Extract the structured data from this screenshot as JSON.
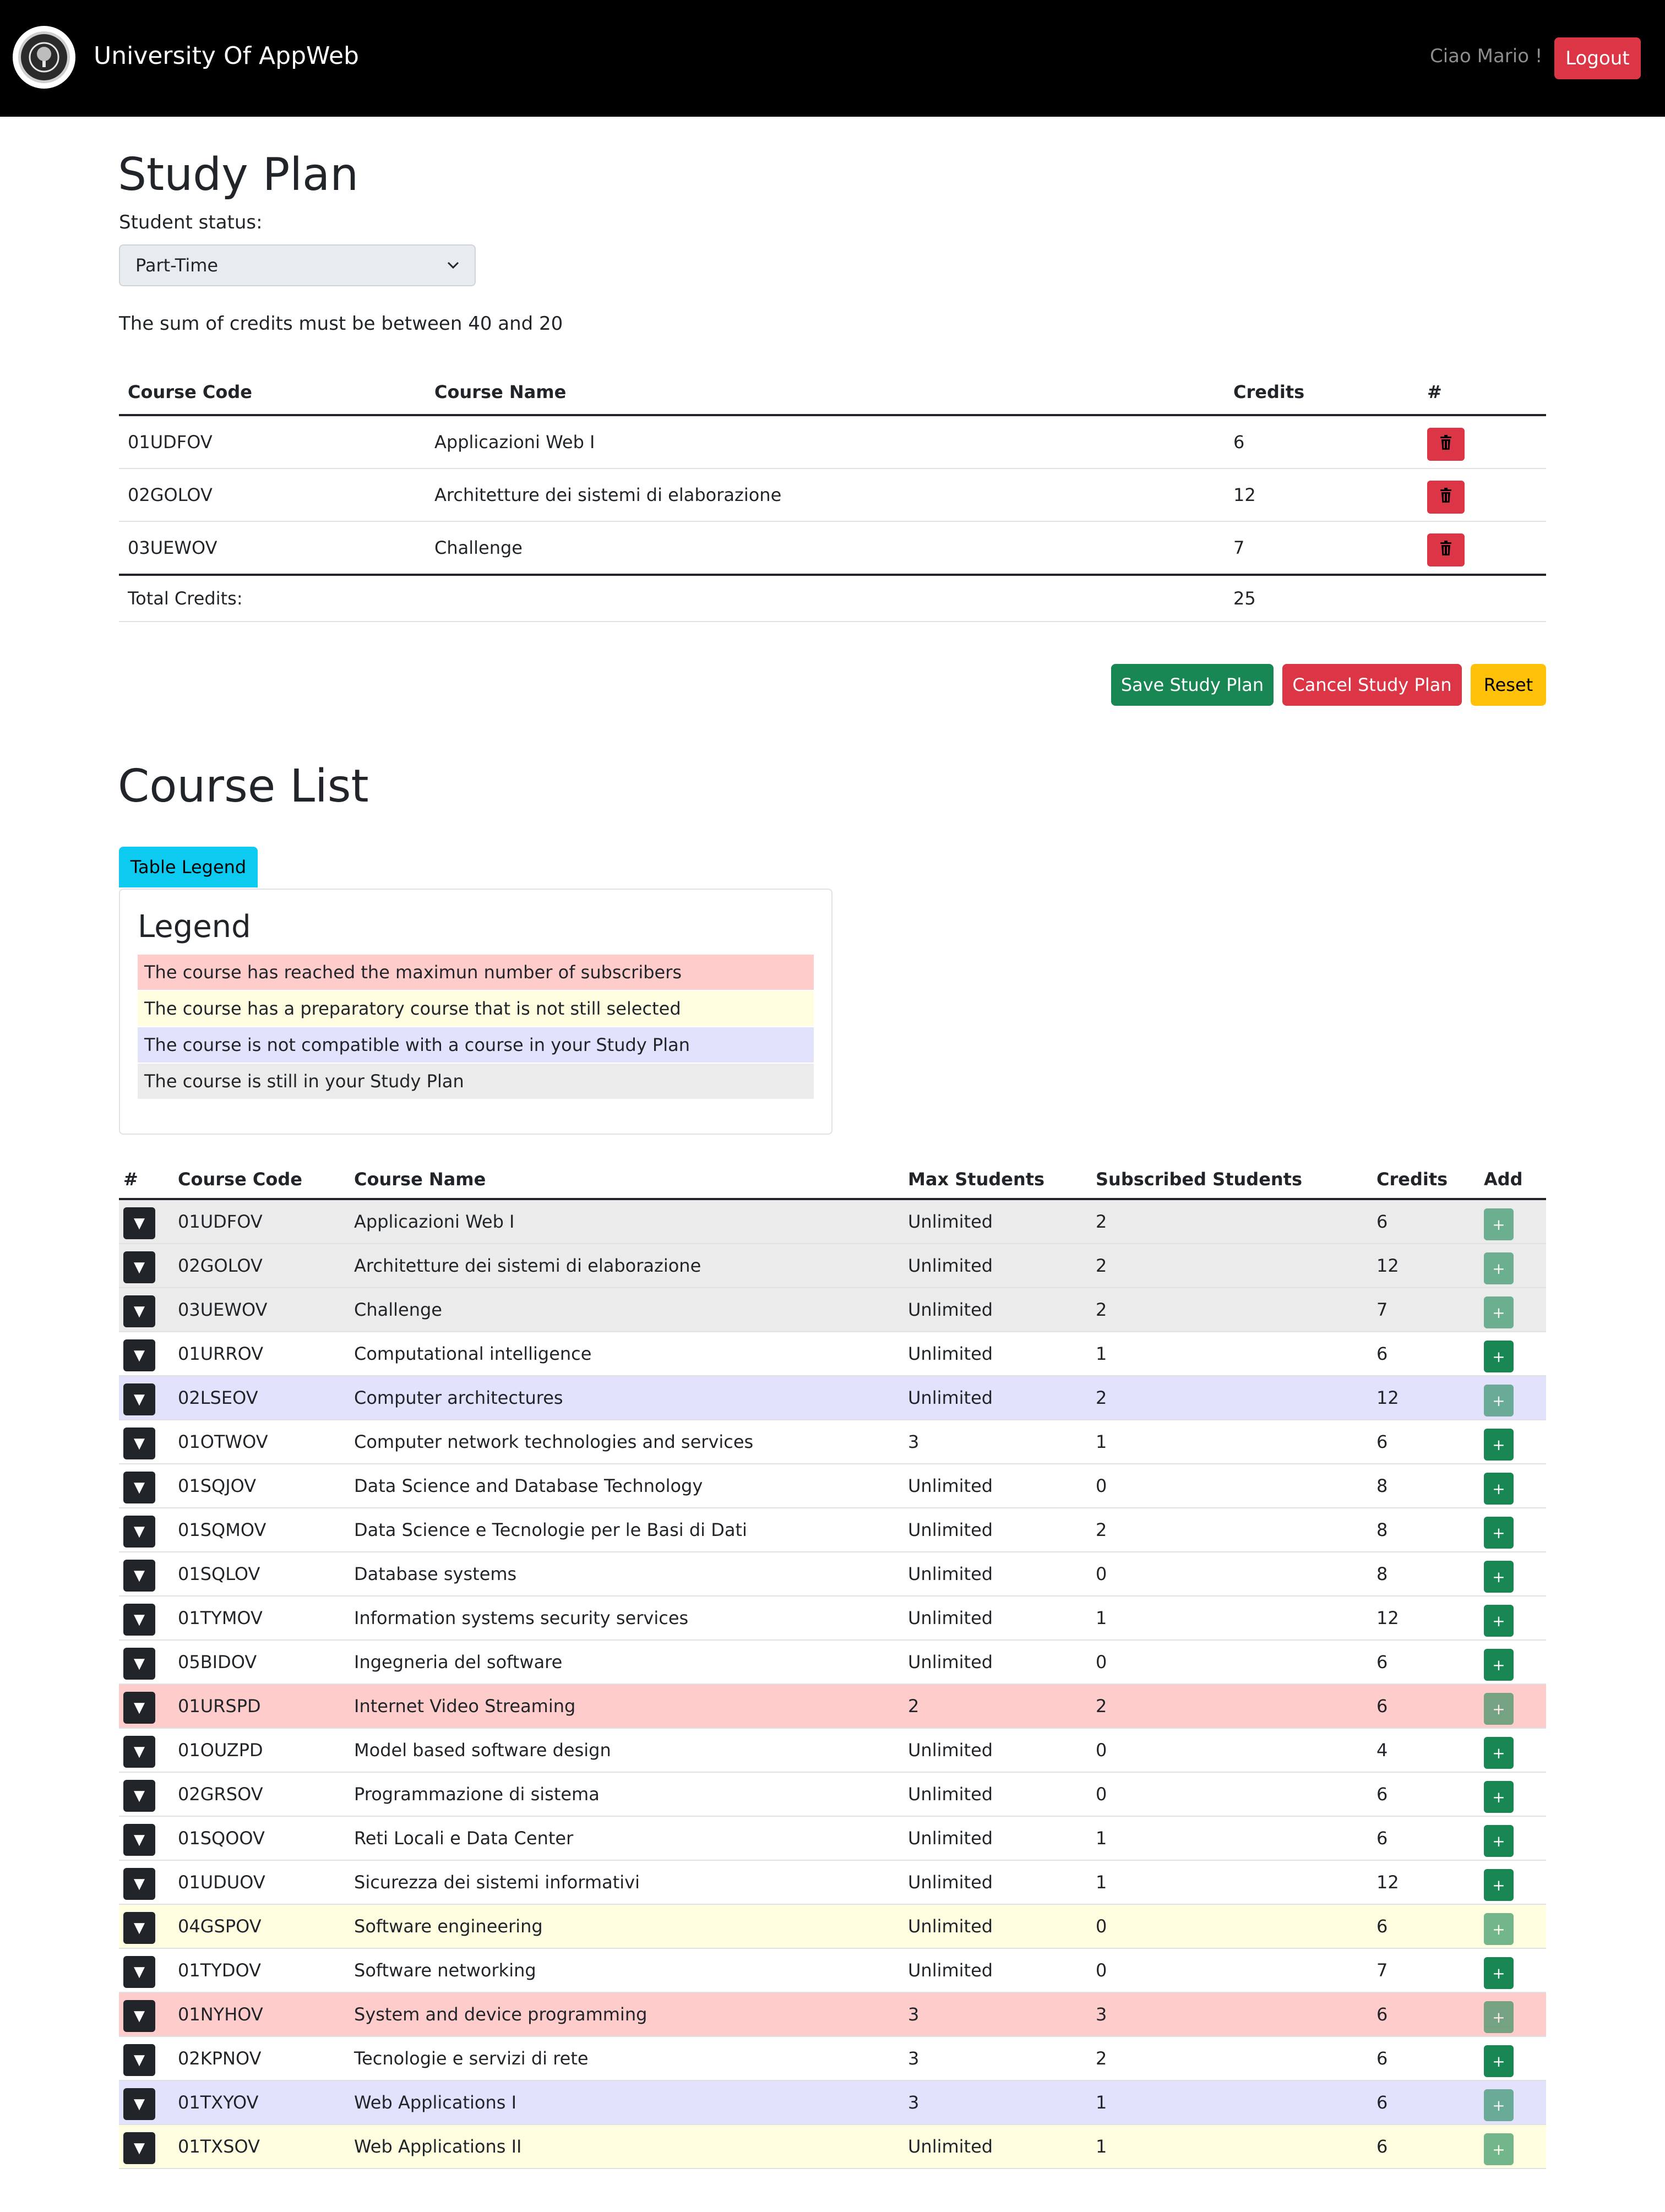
{
  "navbar": {
    "brand": "University Of AppWeb",
    "logo_icon": "university-seal-icon",
    "greeting": "Ciao Mario !",
    "logout_label": "Logout"
  },
  "study_plan": {
    "title": "Study Plan",
    "status_label": "Student status:",
    "status_value": "Part-Time",
    "credits_note": "The sum of credits must be between 40 and 20",
    "headers": [
      "Course Code",
      "Course Name",
      "Credits",
      "#"
    ],
    "rows": [
      {
        "code": "01UDFOV",
        "name": "Applicazioni Web I",
        "credits": "6"
      },
      {
        "code": "02GOLOV",
        "name": "Architetture dei sistemi di elaborazione",
        "credits": "12"
      },
      {
        "code": "03UEWOV",
        "name": "Challenge",
        "credits": "7"
      }
    ],
    "total_label": "Total Credits:",
    "total_value": "25",
    "buttons": {
      "save": "Save Study Plan",
      "cancel": "Cancel Study Plan",
      "reset": "Reset"
    }
  },
  "course_list": {
    "title": "Course List",
    "legend_button": "Table Legend",
    "legend_title": "Legend",
    "legend_items": [
      {
        "text": "The course has reached the maximun number of subscribers",
        "color": "#ffcccc"
      },
      {
        "text": "The course has a preparatory course that is not still selected",
        "color": "#fffde0"
      },
      {
        "text": "The course is not compatible with a course in your Study Plan",
        "color": "#e2e2fc"
      },
      {
        "text": "The course is still in your Study Plan",
        "color": "#ebebeb"
      }
    ],
    "headers": [
      "#",
      "Course Code",
      "Course Name",
      "Max Students",
      "Subscribed Students",
      "Credits",
      "Add"
    ],
    "rows": [
      {
        "code": "01UDFOV",
        "name": "Applicazioni Web I",
        "max": "Unlimited",
        "subscribed": "2",
        "credits": "6",
        "status": "in-plan"
      },
      {
        "code": "02GOLOV",
        "name": "Architetture dei sistemi di elaborazione",
        "max": "Unlimited",
        "subscribed": "2",
        "credits": "12",
        "status": "in-plan"
      },
      {
        "code": "03UEWOV",
        "name": "Challenge",
        "max": "Unlimited",
        "subscribed": "2",
        "credits": "7",
        "status": "in-plan"
      },
      {
        "code": "01URROV",
        "name": "Computational intelligence",
        "max": "Unlimited",
        "subscribed": "1",
        "credits": "6",
        "status": "none"
      },
      {
        "code": "02LSEOV",
        "name": "Computer architectures",
        "max": "Unlimited",
        "subscribed": "2",
        "credits": "12",
        "status": "incompatible"
      },
      {
        "code": "01OTWOV",
        "name": "Computer network technologies and services",
        "max": "3",
        "subscribed": "1",
        "credits": "6",
        "status": "none"
      },
      {
        "code": "01SQJOV",
        "name": "Data Science and Database Technology",
        "max": "Unlimited",
        "subscribed": "0",
        "credits": "8",
        "status": "none"
      },
      {
        "code": "01SQMOV",
        "name": "Data Science e Tecnologie per le Basi di Dati",
        "max": "Unlimited",
        "subscribed": "2",
        "credits": "8",
        "status": "none"
      },
      {
        "code": "01SQLOV",
        "name": "Database systems",
        "max": "Unlimited",
        "subscribed": "0",
        "credits": "8",
        "status": "none"
      },
      {
        "code": "01TYMOV",
        "name": "Information systems security services",
        "max": "Unlimited",
        "subscribed": "1",
        "credits": "12",
        "status": "none"
      },
      {
        "code": "05BIDOV",
        "name": "Ingegneria del software",
        "max": "Unlimited",
        "subscribed": "0",
        "credits": "6",
        "status": "none"
      },
      {
        "code": "01URSPD",
        "name": "Internet Video Streaming",
        "max": "2",
        "subscribed": "2",
        "credits": "6",
        "status": "full"
      },
      {
        "code": "01OUZPD",
        "name": "Model based software design",
        "max": "Unlimited",
        "subscribed": "0",
        "credits": "4",
        "status": "none"
      },
      {
        "code": "02GRSOV",
        "name": "Programmazione di sistema",
        "max": "Unlimited",
        "subscribed": "0",
        "credits": "6",
        "status": "none"
      },
      {
        "code": "01SQOOV",
        "name": "Reti Locali e Data Center",
        "max": "Unlimited",
        "subscribed": "1",
        "credits": "6",
        "status": "none"
      },
      {
        "code": "01UDUOV",
        "name": "Sicurezza dei sistemi informativi",
        "max": "Unlimited",
        "subscribed": "1",
        "credits": "12",
        "status": "none"
      },
      {
        "code": "04GSPOV",
        "name": "Software engineering",
        "max": "Unlimited",
        "subscribed": "0",
        "credits": "6",
        "status": "preparatory"
      },
      {
        "code": "01TYDOV",
        "name": "Software networking",
        "max": "Unlimited",
        "subscribed": "0",
        "credits": "7",
        "status": "none"
      },
      {
        "code": "01NYHOV",
        "name": "System and device programming",
        "max": "3",
        "subscribed": "3",
        "credits": "6",
        "status": "full"
      },
      {
        "code": "02KPNOV",
        "name": "Tecnologie e servizi di rete",
        "max": "3",
        "subscribed": "2",
        "credits": "6",
        "status": "none"
      },
      {
        "code": "01TXYOV",
        "name": "Web Applications I",
        "max": "3",
        "subscribed": "1",
        "credits": "6",
        "status": "incompatible"
      },
      {
        "code": "01TXSOV",
        "name": "Web Applications II",
        "max": "Unlimited",
        "subscribed": "1",
        "credits": "6",
        "status": "preparatory"
      }
    ],
    "expand_glyph": "▼",
    "add_glyph": "+"
  },
  "colors": {
    "full": "#ffcccc",
    "preparatory": "#fffde0",
    "incompatible": "#e2e2fc",
    "in-plan": "#ebebeb",
    "none": "#ffffff",
    "danger": "#dc3545",
    "success": "#198754",
    "warning": "#ffc107",
    "info": "#0dcaf0"
  }
}
